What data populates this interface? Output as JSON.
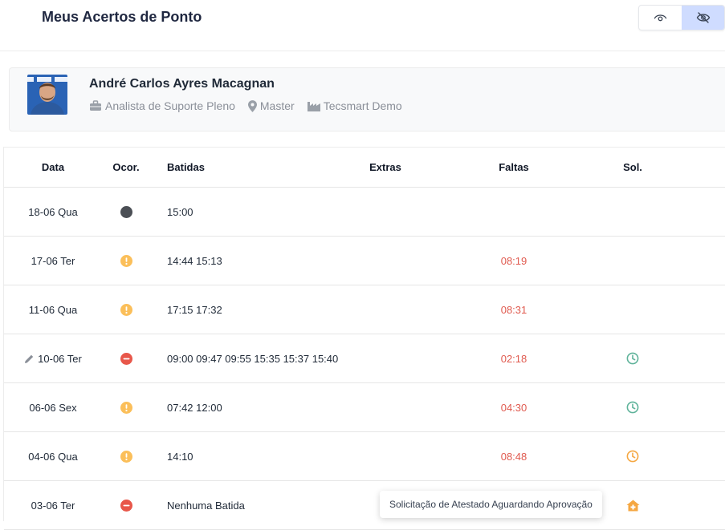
{
  "header": {
    "title": "Meus Acertos de Ponto"
  },
  "profile": {
    "name": "André Carlos Ayres Macagnan",
    "role": "Analista de Suporte Pleno",
    "location": "Master",
    "company": "Tecsmart Demo"
  },
  "table": {
    "headers": {
      "data": "Data",
      "ocor": "Ocor.",
      "batidas": "Batidas",
      "extras": "Extras",
      "faltas": "Faltas",
      "sol": "Sol."
    },
    "rows": [
      {
        "data": "18-06 Qua",
        "ocor": "gray",
        "batidas": "15:00",
        "extras": "",
        "faltas": "",
        "sol": "",
        "edited": false
      },
      {
        "data": "17-06 Ter",
        "ocor": "orange",
        "batidas": "14:44 15:13",
        "extras": "",
        "faltas": "08:19",
        "sol": "",
        "edited": false
      },
      {
        "data": "11-06 Qua",
        "ocor": "orange",
        "batidas": "17:15 17:32",
        "extras": "",
        "faltas": "08:31",
        "sol": "",
        "edited": false
      },
      {
        "data": "10-06 Ter",
        "ocor": "red",
        "batidas": "09:00 09:47 09:55 15:35 15:37 15:40",
        "extras": "",
        "faltas": "02:18",
        "sol": "clock-green",
        "edited": true
      },
      {
        "data": "06-06 Sex",
        "ocor": "orange",
        "batidas": "07:42 12:00",
        "extras": "",
        "faltas": "04:30",
        "sol": "clock-green",
        "edited": false
      },
      {
        "data": "04-06 Qua",
        "ocor": "orange",
        "batidas": "14:10",
        "extras": "",
        "faltas": "08:48",
        "sol": "clock-orange",
        "edited": false
      },
      {
        "data": "03-06 Ter",
        "ocor": "red",
        "batidas": "Nenhuma Batida",
        "extras": "",
        "faltas": "",
        "sol": "house-orange",
        "edited": false
      }
    ]
  },
  "tooltip": {
    "text": "Solicitação de Atestado Aguardando Aprovação"
  },
  "colors": {
    "accent": "#cfdcff",
    "falta": "#e05a4f",
    "green": "#5fb39a",
    "orange": "#f5a742",
    "red": "#e8574a",
    "gray": "#4b4f55"
  }
}
